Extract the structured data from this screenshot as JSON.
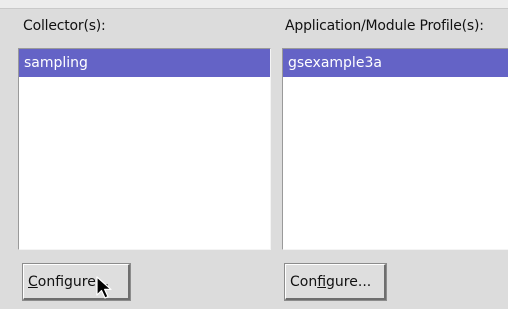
{
  "collectors": {
    "label": "Collector(s):",
    "items": [
      {
        "label": "sampling",
        "selected": true
      }
    ],
    "configure_button": {
      "mnemonic": "C",
      "rest": "onfigure..."
    }
  },
  "profiles": {
    "label": "Application/Module Profile(s):",
    "items": [
      {
        "label": "gsexample3a",
        "selected": true
      }
    ],
    "configure_button": {
      "pre": "Con",
      "mnemonic": "f",
      "post": "igure..."
    }
  },
  "colors": {
    "background": "#dcdcdc",
    "selection": "#6463c6",
    "list_background": "#ffffff"
  },
  "icons": {
    "pointer": "mouse-pointer-icon"
  }
}
